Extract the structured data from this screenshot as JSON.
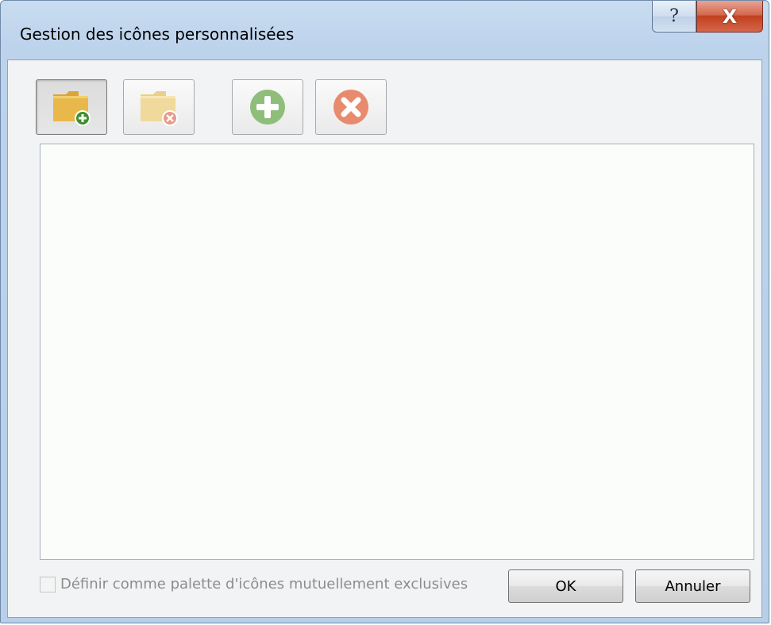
{
  "window": {
    "title": "Gestion des icônes personnalisées",
    "help_label": "?",
    "close_label": "X"
  },
  "toolbar": {
    "buttons": [
      {
        "name": "add-folder",
        "icon": "folder-add-icon",
        "state": "pressed"
      },
      {
        "name": "remove-folder",
        "icon": "folder-remove-icon",
        "state": "disabled"
      },
      {
        "name": "add-icon",
        "icon": "plus-circle-icon",
        "state": "disabled"
      },
      {
        "name": "remove-icon",
        "icon": "x-circle-icon",
        "state": "disabled"
      }
    ]
  },
  "options": {
    "exclusive_palette_label": "Définir comme palette d'icônes mutuellement exclusives",
    "exclusive_palette_checked": false
  },
  "footer": {
    "ok_label": "OK",
    "cancel_label": "Annuler"
  },
  "colors": {
    "folder": "#e8b84a",
    "folder_faded": "#f0d99a",
    "green_plus": "#8fbe7a",
    "red_x": "#e88a6e"
  }
}
